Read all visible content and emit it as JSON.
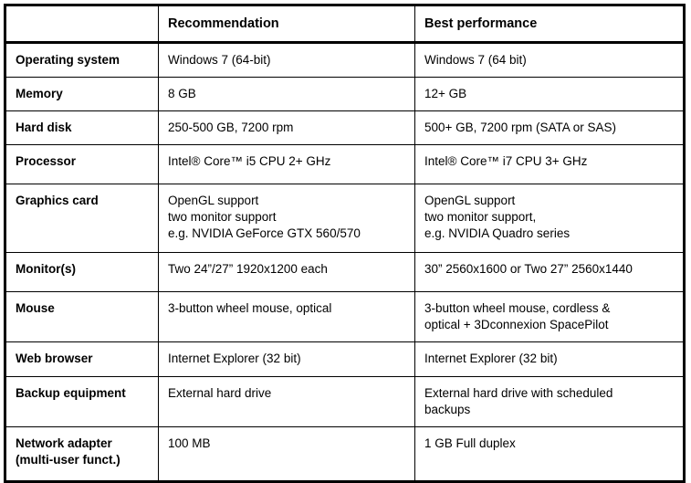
{
  "table": {
    "columns": [
      {
        "key": "label",
        "header": ""
      },
      {
        "key": "recommendation",
        "header": "Recommendation"
      },
      {
        "key": "best",
        "header": "Best performance"
      }
    ],
    "rows": [
      {
        "label": "Operating system",
        "recommendation": "Windows 7 (64-bit)",
        "best": "Windows 7 (64 bit)"
      },
      {
        "label": "Memory",
        "recommendation": "8 GB",
        "best": "12+ GB"
      },
      {
        "label": "Hard disk",
        "recommendation": "250-500 GB, 7200 rpm",
        "best": "500+ GB, 7200 rpm (SATA or SAS)"
      },
      {
        "label": "Processor",
        "recommendation": "Intel® Core™ i5 CPU 2+ GHz",
        "best": "Intel® Core™ i7 CPU 3+ GHz"
      },
      {
        "label": "Graphics card",
        "recommendation": "OpenGL support\ntwo monitor support\ne.g. NVIDIA GeForce GTX 560/570",
        "best": "OpenGL support\ntwo monitor support,\ne.g. NVIDIA Quadro series"
      },
      {
        "label": "Monitor(s)",
        "recommendation": "Two 24”/27” 1920x1200 each",
        "best": "30” 2560x1600 or Two 27” 2560x1440"
      },
      {
        "label": "Mouse",
        "recommendation": "3-button wheel mouse, optical",
        "best": "3-button wheel mouse, cordless &\noptical + 3Dconnexion SpacePilot"
      },
      {
        "label": "Web browser",
        "recommendation": "Internet Explorer (32 bit)",
        "best": "Internet Explorer (32 bit)"
      },
      {
        "label": "Backup equipment",
        "recommendation": "External hard drive",
        "best": "External hard drive with scheduled\nbackups"
      },
      {
        "label": "Network adapter\n(multi-user funct.)",
        "recommendation": "100 MB",
        "best": "1 GB Full duplex"
      }
    ]
  },
  "colors": {
    "border": "#000000",
    "text": "#000000",
    "background": "#ffffff"
  }
}
